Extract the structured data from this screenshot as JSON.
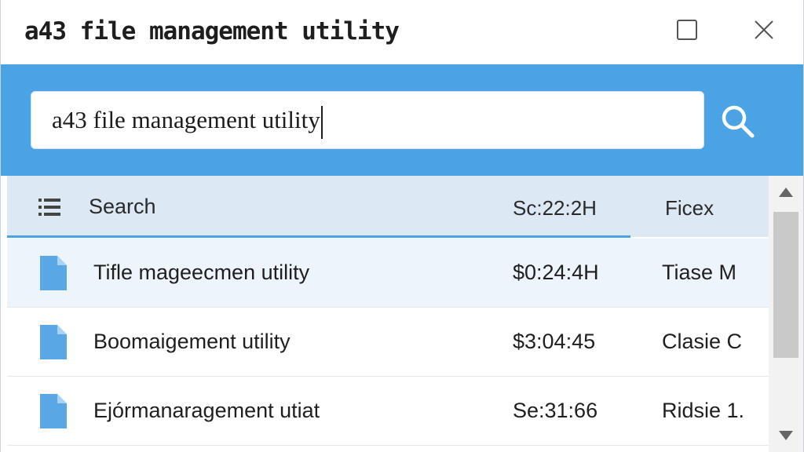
{
  "window": {
    "title": "a43 file management utility"
  },
  "icons": {
    "maximize": "maximize-icon",
    "close": "close-icon",
    "search": "search-icon",
    "list": "list-icon",
    "file": "file-icon",
    "scroll_up": "scroll-up-icon",
    "scroll_down": "scroll-down-icon"
  },
  "search": {
    "value": "a43 file management utility"
  },
  "list": {
    "header": {
      "name": "Search",
      "time": "Sc:22:2H",
      "type": "Ficex"
    },
    "rows": [
      {
        "name": "Tifle mageecmen utility",
        "time": "$0:24:4H",
        "type": "Tiase M"
      },
      {
        "name": "Boomaigement utility",
        "time": "$3:04:45",
        "type": "Clasie C"
      },
      {
        "name": "Ejórmanaragement utiat",
        "time": "Se:31:66",
        "type": "Ridsie 1."
      }
    ]
  },
  "colors": {
    "accent": "#4aa3e4",
    "header_bg": "#dce8f4",
    "selected_row_bg": "#edf4fb",
    "file_icon": "#5aa7e6"
  }
}
